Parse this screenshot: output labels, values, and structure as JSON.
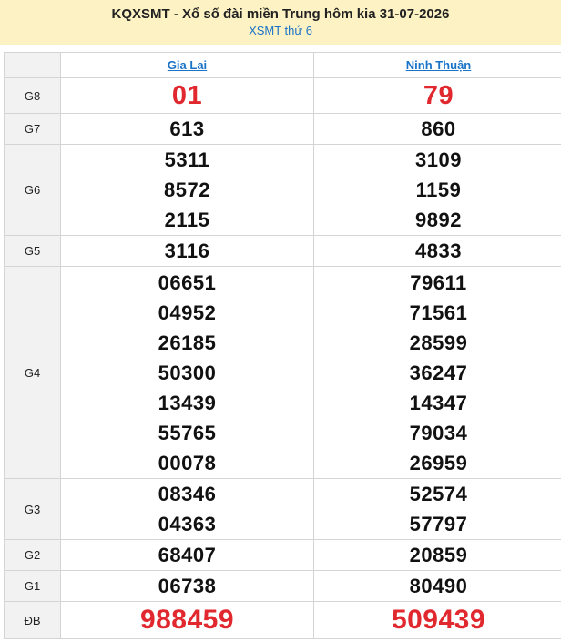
{
  "header": {
    "title": "KQXSMT - Xổ số đài miền Trung hôm kia 31-07-2026",
    "subtitle_link": "XSMT thứ 6"
  },
  "provinces": [
    "Gia Lai",
    "Ninh Thuận"
  ],
  "prizes": [
    {
      "label": "G8",
      "values": [
        [
          "01"
        ],
        [
          "79"
        ]
      ]
    },
    {
      "label": "G7",
      "values": [
        [
          "613"
        ],
        [
          "860"
        ]
      ]
    },
    {
      "label": "G6",
      "values": [
        [
          "5311",
          "8572",
          "2115"
        ],
        [
          "3109",
          "1159",
          "9892"
        ]
      ]
    },
    {
      "label": "G5",
      "values": [
        [
          "3116"
        ],
        [
          "4833"
        ]
      ]
    },
    {
      "label": "G4",
      "values": [
        [
          "06651",
          "04952",
          "26185",
          "50300",
          "13439",
          "55765",
          "00078"
        ],
        [
          "79611",
          "71561",
          "28599",
          "36247",
          "14347",
          "79034",
          "26959"
        ]
      ]
    },
    {
      "label": "G3",
      "values": [
        [
          "08346",
          "04363"
        ],
        [
          "52574",
          "57797"
        ]
      ]
    },
    {
      "label": "G2",
      "values": [
        [
          "68407"
        ],
        [
          "20859"
        ]
      ]
    },
    {
      "label": "G1",
      "values": [
        [
          "06738"
        ],
        [
          "80490"
        ]
      ]
    },
    {
      "label": "ĐB",
      "values": [
        [
          "988459"
        ],
        [
          "509439"
        ]
      ]
    }
  ],
  "colors": {
    "header_bg": "#fdf2c4",
    "link": "#1a73c7",
    "highlight_red": "#e0282e",
    "label_bg": "#f2f2f2",
    "border": "#d4d4d4"
  }
}
